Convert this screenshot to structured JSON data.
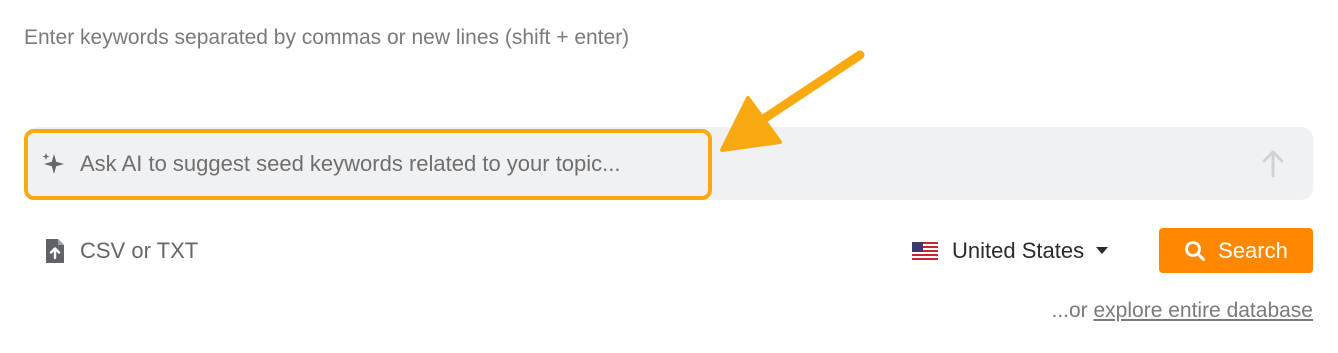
{
  "keywords_input": {
    "placeholder": "Enter keywords separated by commas or new lines (shift + enter)",
    "value": ""
  },
  "ai_prompt": {
    "placeholder": "Ask AI to suggest seed keywords related to your topic...",
    "icon": "sparkle-icon",
    "send_icon": "arrow-up-icon",
    "highlight_color": "#f7a90f"
  },
  "upload": {
    "label": "CSV or TXT",
    "icon": "file-upload-icon"
  },
  "country_select": {
    "label": "United States",
    "icon": "us-flag-icon"
  },
  "search_button": {
    "label": "Search",
    "icon": "search-icon",
    "color": "#ff8800"
  },
  "explore": {
    "prefix": "...or ",
    "link_text": "explore entire database"
  },
  "annotation": {
    "arrow_color": "#f7a90f"
  }
}
